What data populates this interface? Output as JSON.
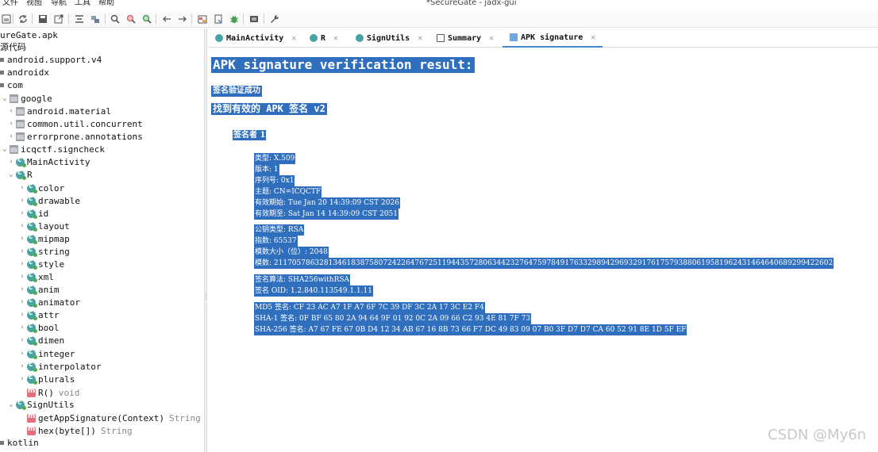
{
  "menu": {
    "file": "文件",
    "view": "视图",
    "nav": "导航",
    "tools": "工具",
    "help": "帮助"
  },
  "window_title": "*SecureGate - jadx-gui",
  "toolbar_icons": [
    "open-file-icon",
    "sync-icon",
    "save-icon",
    "export-icon",
    "sync-tree-icon",
    "flatten-icon",
    "search-icon",
    "search-class-icon",
    "search-usage-icon",
    "back-icon",
    "forward-icon",
    "decompile-icon",
    "bookmark-icon",
    "debug-icon",
    "log-icon",
    "settings-icon"
  ],
  "tree": {
    "root": "ureGate.apk",
    "source": "源代码",
    "pkg_support": "android.support.v4",
    "pkg_androidx": "androidx",
    "pkg_com": "com",
    "pkg_google": "google",
    "pkg_material": "android.material",
    "pkg_concurrent": "common.util.concurrent",
    "pkg_errorprone": "errorprone.annotations",
    "pkg_signcheck": "icqctf.signcheck",
    "cls_main": "MainActivity",
    "cls_r": "R",
    "r_items": [
      "color",
      "drawable",
      "id",
      "layout",
      "mipmap",
      "string",
      "style",
      "xml",
      "anim",
      "animator",
      "attr",
      "bool",
      "dimen",
      "integer",
      "interpolator",
      "plurals"
    ],
    "r_ctor": "R()",
    "r_ctor_type": "void",
    "cls_signutils": "SignUtils",
    "m_getsig": "getAppSignature(Context)",
    "m_getsig_type": "String",
    "m_hex": "hex(byte[])",
    "m_hex_type": "String",
    "pkg_kotlin": "kotlin"
  },
  "tabs": [
    "MainActivity",
    "R",
    "SignUtils",
    "Summary",
    "APK signature"
  ],
  "content": {
    "heading": "APK signature verification result:",
    "status": "签名验证成功",
    "found": "找到有效的 APK 签名 v2",
    "signer": "签名者 1",
    "cert": [
      "类型: X.509",
      "版本: 1",
      "序列号: 0x1",
      "主题: CN=ICQCTF",
      "有效期始: Tue Jan 20 14:39:09 CST 2026",
      "有效期至: Sat Jan 14 14:39:09 CST 2051"
    ],
    "key": [
      "公钥类型: RSA",
      "指数: 65537",
      "模数大小（位）: 2048",
      "模数: 211705786328134618387580724226476725119443572806344232764759784917633298942969329176175793880619581962431464640689299422602"
    ],
    "algo": [
      "签名算法: SHA256withRSA",
      "签名 OID: 1.2.840.113549.1.1.11"
    ],
    "hashes": [
      "MD5 签名: CF 23 AC A7 1F A7 6F 7C 39 DF 3C 2A 17 3C E2 F4",
      "SHA-1 签名: 0F BF 65 80 2A 94 64 9F 01 92 0C 2A 09 66 C2 93 4E 81 7F 73",
      "SHA-256 签名: A7 67 FE 67 0B D4 12 34 AB 67 16 8B 73 66 F7 DC 49 83 09 07 B0 3F D7 D7 CA 60 52 91 8E 1D 5F EF"
    ]
  },
  "watermark": "CSDN @My6n",
  "colors": {
    "selection": "#2f6fbe",
    "class_icon": "#4aa3a3",
    "method_icon": "#e0707a"
  }
}
